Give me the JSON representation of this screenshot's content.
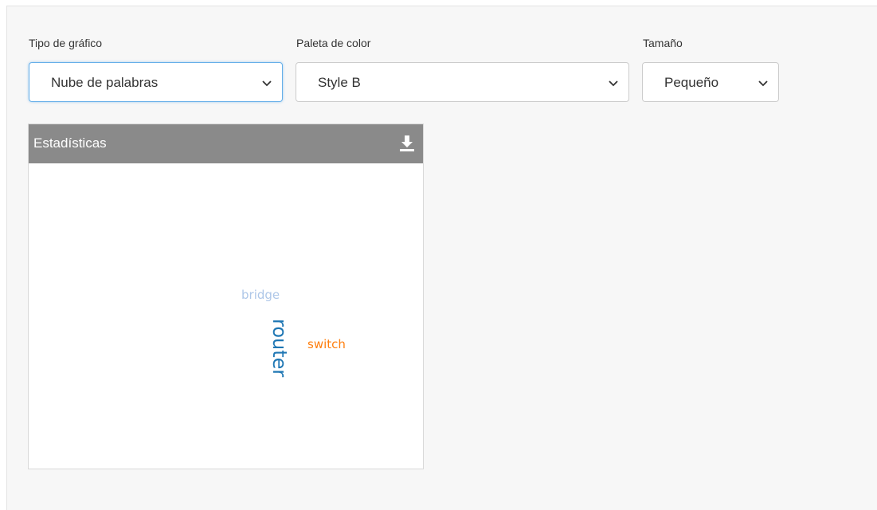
{
  "filters": {
    "chart_type": {
      "label": "Tipo de gráfico",
      "value": "Nube de palabras"
    },
    "palette": {
      "label": "Paleta de color",
      "value": "Style B"
    },
    "size": {
      "label": "Tamaño",
      "value": "Pequeño"
    }
  },
  "widget": {
    "title": "Estadísticas",
    "download_icon": "download-icon"
  },
  "word_cloud": {
    "words": [
      {
        "text": "router",
        "color": "#1f77b4",
        "orientation": "vertical"
      },
      {
        "text": "switch",
        "color": "#ff7f0e",
        "orientation": "horizontal"
      },
      {
        "text": "bridge",
        "color": "#aec7e8",
        "orientation": "horizontal"
      }
    ]
  },
  "colors": {
    "panel_bg": "#f7f7f7",
    "widget_header": "#8a8a8a",
    "focus_border": "#66afe9"
  }
}
